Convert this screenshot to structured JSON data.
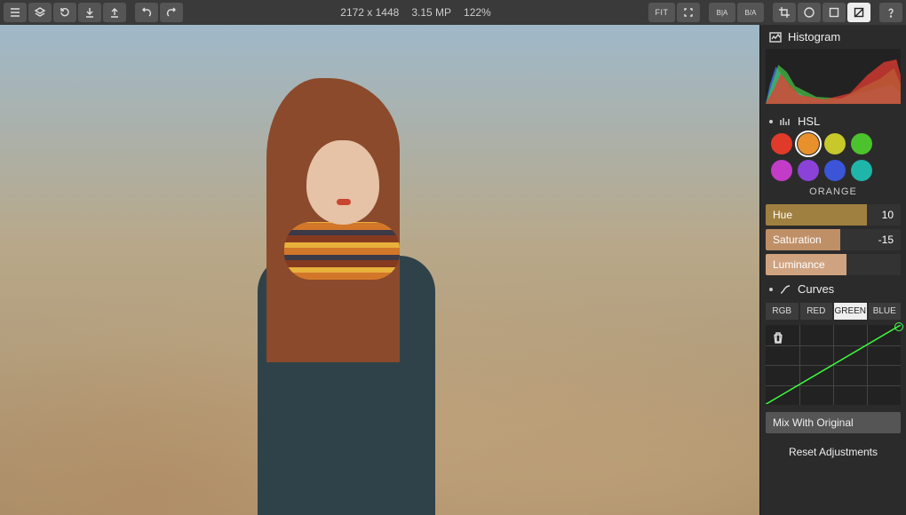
{
  "status": {
    "dimensions": "2172 x 1448",
    "megapixels": "3.15 MP",
    "zoom": "122%"
  },
  "toolbar": {
    "fit_label": "FIT",
    "beforeafter_label": "B|A",
    "split_label": "B/A"
  },
  "panel": {
    "histogram_title": "Histogram",
    "hsl": {
      "title": "HSL",
      "swatches": [
        {
          "color": "#e03a2a",
          "name": "red"
        },
        {
          "color": "#e8902b",
          "name": "orange",
          "selected": true
        },
        {
          "color": "#c7c82a",
          "name": "yellow"
        },
        {
          "color": "#4cc32d",
          "name": "green"
        },
        {
          "color": "#c23cc7",
          "name": "magenta"
        },
        {
          "color": "#8a42d8",
          "name": "purple"
        },
        {
          "color": "#3a55d8",
          "name": "blue"
        },
        {
          "color": "#1fb5a9",
          "name": "aqua"
        }
      ],
      "selected_label": "ORANGE",
      "hue": {
        "label": "Hue",
        "value": "10"
      },
      "saturation": {
        "label": "Saturation",
        "value": "-15"
      },
      "luminance": {
        "label": "Luminance",
        "value": ""
      }
    },
    "curves": {
      "title": "Curves",
      "tabs": {
        "rgb": "RGB",
        "red": "RED",
        "green": "GREEN",
        "blue": "BLUE"
      },
      "active_tab": "green"
    },
    "mix_label": "Mix With Original",
    "reset_label": "Reset Adjustments"
  }
}
